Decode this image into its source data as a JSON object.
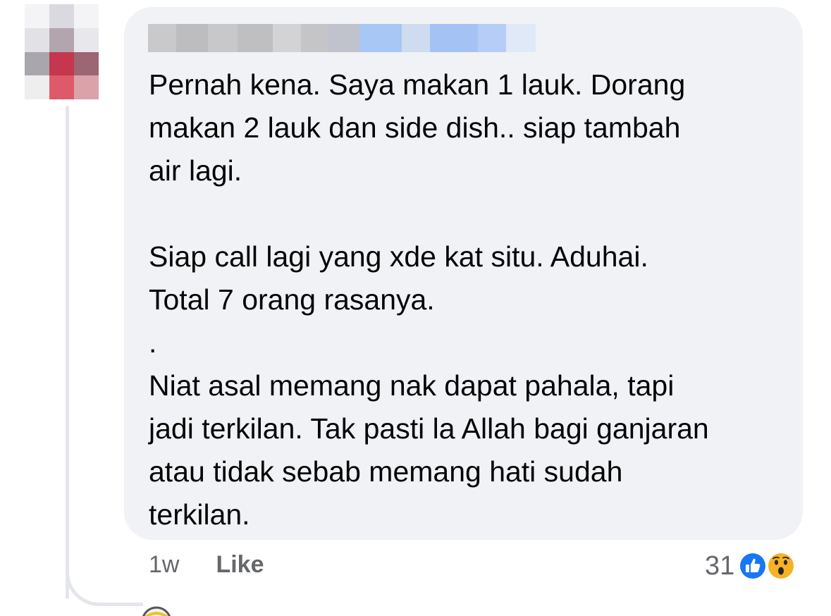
{
  "comment": {
    "author_name": "",
    "text": "Pernah kena. Saya makan 1 lauk. Dorang\nmakan 2 lauk dan side dish.. siap tambah\nair lagi.\n\nSiap call lagi yang xde kat situ. Aduhai.\nTotal 7 orang rasanya.\n.\nNiat asal memang nak dapat pahala, tapi\njadi terkilan. Tak pasti la Allah bagi ganjaran\natau tidak sebab memang hati sudah\nterkilan.",
    "timestamp": "1w",
    "like_label": "Like",
    "reaction_count": "31",
    "reactions": [
      "like-icon",
      "wow-icon"
    ]
  },
  "colors": {
    "bubble": "#f0f2f5",
    "text": "#050505",
    "meta": "#65676b",
    "like_blue": "#1877f2",
    "wow_yellow": "#f7b125"
  }
}
